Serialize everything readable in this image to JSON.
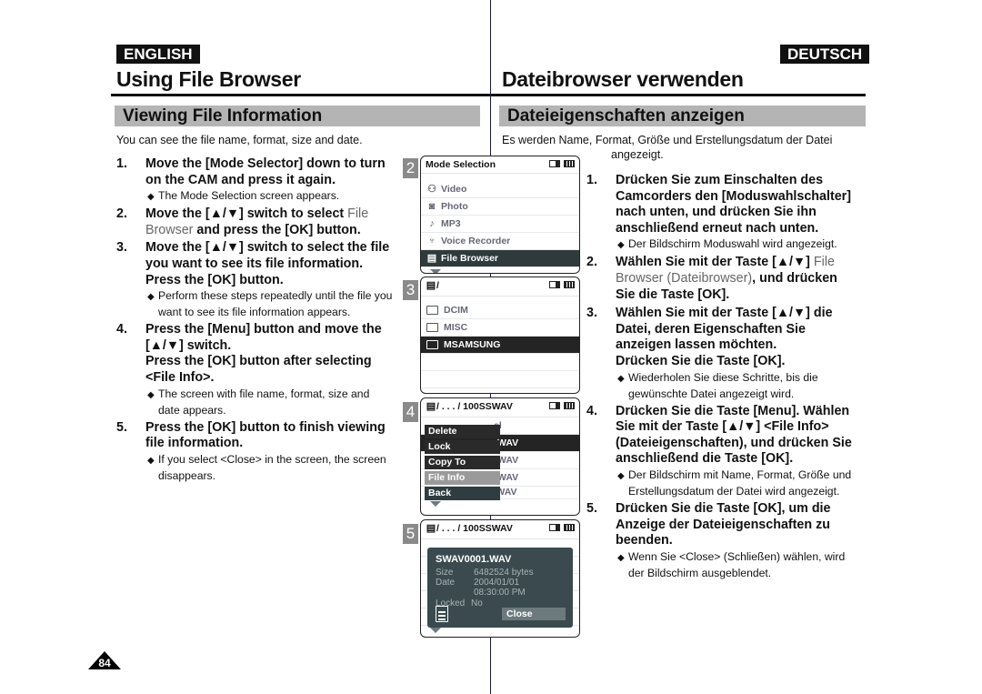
{
  "page_number": "84",
  "left": {
    "lang_label": "ENGLISH",
    "title": "Using File Browser",
    "section": "Viewing File Information",
    "intro": "You can see the file name, format, size and date.",
    "steps": [
      {
        "num": "1.",
        "text": "Move the [Mode Selector] down to turn on the CAM and press it again.",
        "notes": [
          "The Mode Selection screen appears."
        ]
      },
      {
        "num": "2.",
        "text_a": "Move the [▲/▼] switch to select ",
        "text_light": "File Browser",
        "text_b": " and press the [OK] button.",
        "notes": []
      },
      {
        "num": "3.",
        "text": "Move the [▲/▼] switch to select the file you want to see its file information.",
        "text2": "Press the [OK] button.",
        "notes": [
          "Perform these steps repeatedly until the file you want to see its file information appears."
        ]
      },
      {
        "num": "4.",
        "text": "Press the [Menu] button and move the [▲/▼] switch.",
        "text2": "Press the [OK] button after selecting <File Info>.",
        "notes": [
          "The screen with file name, format, size and date appears."
        ]
      },
      {
        "num": "5.",
        "text": "Press the [OK] button to finish viewing file information.",
        "notes": [
          "If you select <Close> in the screen, the screen disappears."
        ]
      }
    ]
  },
  "right": {
    "lang_label": "DEUTSCH",
    "title": "Dateibrowser verwenden",
    "section": "Dateieigenschaften anzeigen",
    "intro_line1": "Es werden Name, Format, Größe und Erstellungsdatum der Datei",
    "intro_line2": "angezeigt.",
    "steps": [
      {
        "num": "1.",
        "text": "Drücken Sie zum Einschalten des Camcorders den [Moduswahlschalter] nach unten, und drücken Sie ihn anschließend erneut nach unten.",
        "notes": [
          "Der Bildschirm Moduswahl wird angezeigt."
        ]
      },
      {
        "num": "2.",
        "text_a": "Wählen Sie mit der Taste [▲/▼] ",
        "text_light": "File Browser (Dateibrowser)",
        "text_b": ", und drücken Sie die Taste [OK].",
        "notes": []
      },
      {
        "num": "3.",
        "text": "Wählen Sie mit der Taste [▲/▼] die Datei, deren Eigenschaften Sie anzeigen lassen möchten.",
        "text2": "Drücken Sie die Taste [OK].",
        "notes": [
          "Wiederholen Sie diese Schritte, bis die gewünschte Datei angezeigt wird."
        ]
      },
      {
        "num": "4.",
        "text": "Drücken Sie die Taste [Menu]. Wählen Sie mit der Taste [▲/▼] <File Info> (Dateieigenschaften), und drücken Sie anschließend die Taste [OK].",
        "notes": [
          "Der Bildschirm mit Name, Format, Größe und Erstellungsdatum der Datei wird angezeigt."
        ]
      },
      {
        "num": "5.",
        "text": "Drücken Sie die Taste [OK], um die Anzeige der Dateieigenschaften zu beenden.",
        "notes": [
          "Wenn Sie <Close> (Schließen) wählen, wird der Bildschirm ausgeblendet."
        ]
      }
    ]
  },
  "screens": [
    {
      "num": "2",
      "header": "Mode Selection",
      "items": [
        {
          "icon": "video-icon",
          "glyph": "🎥",
          "label": "Video"
        },
        {
          "icon": "camera-icon",
          "glyph": "📷",
          "label": "Photo"
        },
        {
          "icon": "music-note-icon",
          "glyph": "♪",
          "label": "MP3"
        },
        {
          "icon": "microphone-icon",
          "glyph": "🎙",
          "label": "Voice Recorder"
        },
        {
          "icon": "file-icon",
          "glyph": "▤",
          "label": "File Browser",
          "selected": true
        }
      ]
    },
    {
      "num": "3",
      "header": "/",
      "items": [
        {
          "label": "DCIM"
        },
        {
          "label": "MISC"
        },
        {
          "label": "MSAMSUNG",
          "selected": true
        }
      ]
    },
    {
      "num": "4",
      "header": "/ . . . / 100SSWAV",
      "behind": [
        "el",
        "WAV",
        "WAV",
        "WAV",
        "SWAV0004.WAV"
      ],
      "menu": [
        "Delete",
        "Lock",
        "Copy To",
        "File Info",
        "Back"
      ]
    },
    {
      "num": "5",
      "header": "/ . . . / 100SSWAV",
      "info": {
        "filename": "SWAV0001.WAV",
        "size_label": "Size",
        "size": "6482524 bytes",
        "date_label": "Date",
        "date": "2004/01/01",
        "time": "08:30:00 PM",
        "locked_label": "Locked",
        "locked": "No",
        "close": "Close"
      }
    }
  ]
}
